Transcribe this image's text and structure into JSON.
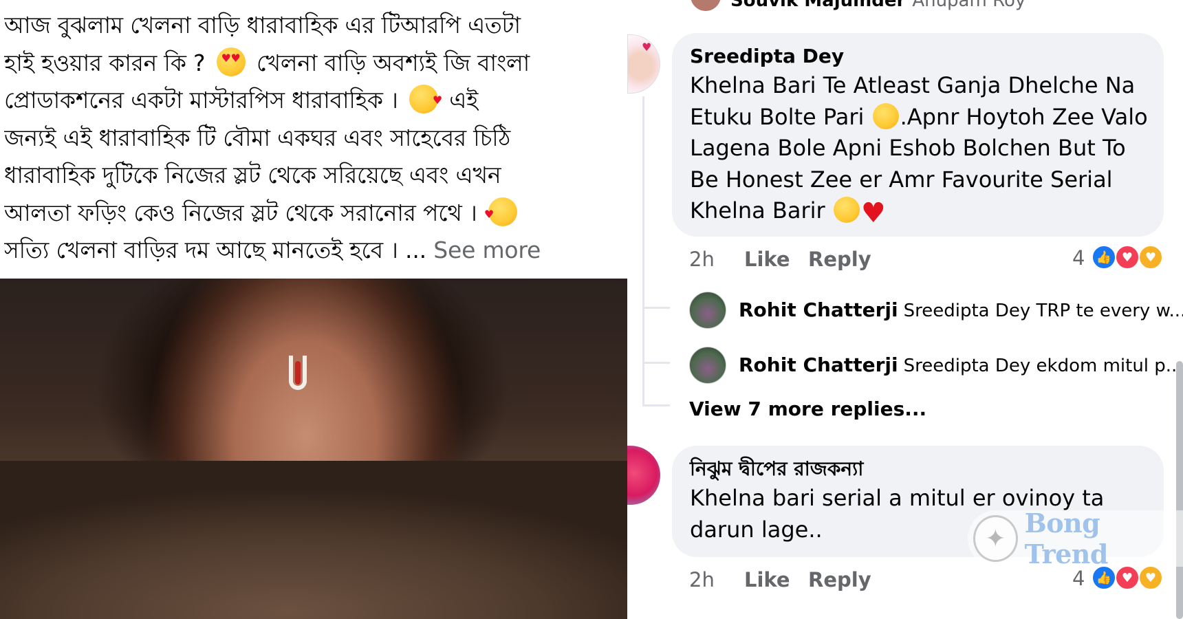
{
  "post": {
    "lines": [
      "আজ বুঝলাম খেলনা বাড়ি ধারাবাহিক এর টিআরপি এতটা",
      "হাই হওয়ার কারন কি ? ",
      " খেলনা বাড়ি অবশ্যই জি বাংলা",
      "প্রোডাকশনের একটা মাস্টারপিস ধারাবাহিক । ",
      " এই",
      "জন্যই এই ধারাবাহিক টি বৌমা একঘর এবং সাহেবের চিঠি",
      "ধারাবাহিক দুটিকে নিজের স্লট থেকে সরিয়েছে এবং এখন",
      "আলতা ফড়িং কেও নিজের স্লট থেকে সরানোর পথে । ",
      "সত্যি খেলনা বাড়ির দম আছে মানতেই হবে । ... "
    ],
    "see_more": "See more",
    "emojis": [
      "heart-eyes-emoji",
      "kissing-heart-emoji",
      "smiling-hearts-emoji"
    ],
    "photo": "woman-buried-in-sand-photo"
  },
  "previous_comment": {
    "author": "Souvik Majumder",
    "text": "Anupam Roy"
  },
  "comments": [
    {
      "author": "Sreedipta Dey",
      "lines": [
        "Khelna Bari Te Atleast Ganja Dhelche Na",
        "Etuku Bolte Pari ",
        ".Apnr Hoytoh Zee Valo",
        "Lagena Bole Apni Eshob Bolchen But To",
        "Be Honest Zee er Amr Favourite Serial",
        "Khelna Barir "
      ],
      "time": "2h",
      "like": "Like",
      "reply": "Reply",
      "reaction_count": "4",
      "reactions": [
        "like",
        "love",
        "care"
      ],
      "replies": [
        {
          "author": "Rohit Chatterji",
          "text": "Sreedipta Dey TRP te every w..."
        },
        {
          "author": "Rohit Chatterji",
          "text": "Sreedipta Dey ekdom mitul p..."
        }
      ],
      "view_more": "View 7 more replies..."
    },
    {
      "author": "নিঝুম দ্বীপের রাজকন্যা",
      "lines": [
        "Khelna bari serial a mitul er ovinoy ta",
        "darun lage.."
      ],
      "time": "2h",
      "like": "Like",
      "reply": "Reply",
      "reaction_count": "4",
      "reactions": [
        "like",
        "love",
        "care"
      ]
    }
  ],
  "watermark": {
    "text": "Bong Trend"
  },
  "colors": {
    "bubble_bg": "#f0f2f5",
    "meta_text": "#65676b",
    "like_blue": "#1877f2",
    "love_red": "#f33e58",
    "care_yellow": "#f7b125"
  }
}
